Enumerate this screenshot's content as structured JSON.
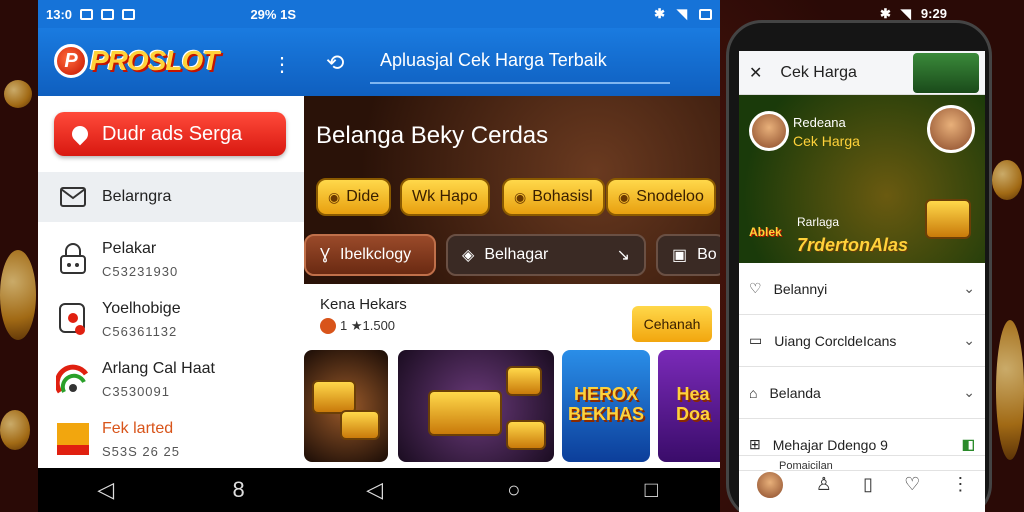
{
  "left": {
    "status": {
      "time": "13:0",
      "right": "29% 1S"
    },
    "logo": {
      "mark": "P",
      "text": "PROSLOT"
    },
    "red_button_label": "Dudr ads Serga",
    "menu": [
      {
        "title": "Belarngra",
        "sub": "",
        "icon": "mail-icon"
      },
      {
        "title": "Pelakar",
        "sub": "C53231930",
        "icon": "lock-icon"
      },
      {
        "title": "Yoelhobige",
        "sub": "C56361132",
        "icon": "pin-icon"
      },
      {
        "title": "Arlang Cal Haat",
        "sub": "C3530091",
        "icon": "chart-icon"
      },
      {
        "title": "Fek larted",
        "sub": "S53S 26 25",
        "icon": "tag-icon"
      }
    ],
    "nav": [
      "◁",
      "8"
    ]
  },
  "mid": {
    "search_text": "Apluasjal Cek Harga Terbaik",
    "hero_title": "Belanga Beky Cerdas",
    "chips": [
      "Dide",
      "Wk Hapo",
      "Bohasisl",
      "Snodeloo"
    ],
    "tabs": [
      "Ibelkclogy",
      "Belhagar",
      "Bo"
    ],
    "promo": {
      "title": "Kena Hekars",
      "meta": "1 ★1.500",
      "button": "Cehanah"
    },
    "games": [
      "",
      "",
      "HEROX BEKHAS",
      "Hea Doa"
    ],
    "nav": [
      "◁",
      "○",
      "□"
    ]
  },
  "right": {
    "status": "9:29",
    "header_title": "Cek Harga",
    "hero": {
      "t1": "Redeana",
      "t2": "Cek Harga",
      "p1": "Rarlaga",
      "p2": "7rdertonAlas",
      "badge": "Ablek"
    },
    "rows": [
      {
        "label": "Belannyi",
        "icon": "heart-icon"
      },
      {
        "label": "Uiang CorcldeIcans",
        "icon": "card-icon"
      },
      {
        "label": "Belanda",
        "icon": "home-icon"
      },
      {
        "label": "Mehajar Ddengo 9",
        "icon": "grid-icon"
      }
    ],
    "bottom_label": "Pomaicilan"
  }
}
